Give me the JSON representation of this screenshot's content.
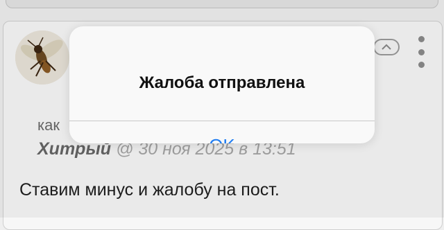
{
  "comment": {
    "avatar_icon": "fly-insect-avatar",
    "collapse_icon": "chevron-up-icon",
    "menu_icon": "vertical-ellipsis-icon",
    "quote_prefix": "как",
    "quote_author": "Хитрый",
    "quote_date": "@ 30 ноя 2025 в 13:51",
    "text": "Ставим минус и жалобу на пост."
  },
  "alert": {
    "title": "Жалоба отправлена",
    "ok_label": "OK"
  },
  "colors": {
    "accent": "#1e7cf2",
    "background": "#efefef",
    "card": "#f7f7f7"
  }
}
